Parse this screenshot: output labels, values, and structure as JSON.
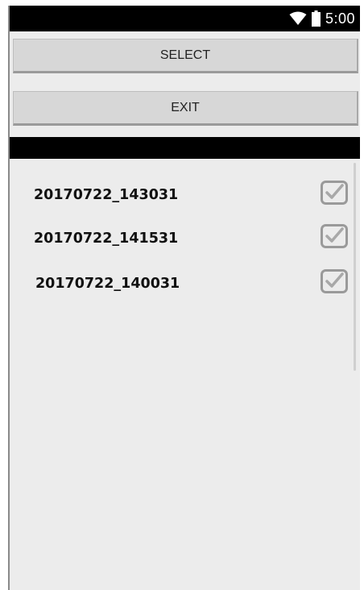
{
  "status_bar": {
    "time": "5:00",
    "icons": [
      "wifi-icon",
      "battery-icon"
    ]
  },
  "buttons": {
    "select_label": "SELECT",
    "exit_label": "EXIT"
  },
  "list": {
    "items": [
      {
        "label": "20170722_143031",
        "checked": true
      },
      {
        "label": "20170722_141531",
        "checked": true
      },
      {
        "label": "20170722_140031",
        "checked": true
      }
    ]
  },
  "colors": {
    "background": "#ececec",
    "button": "#d7d7d7",
    "bar": "#000000",
    "checkbox": "#9a9a9a"
  }
}
